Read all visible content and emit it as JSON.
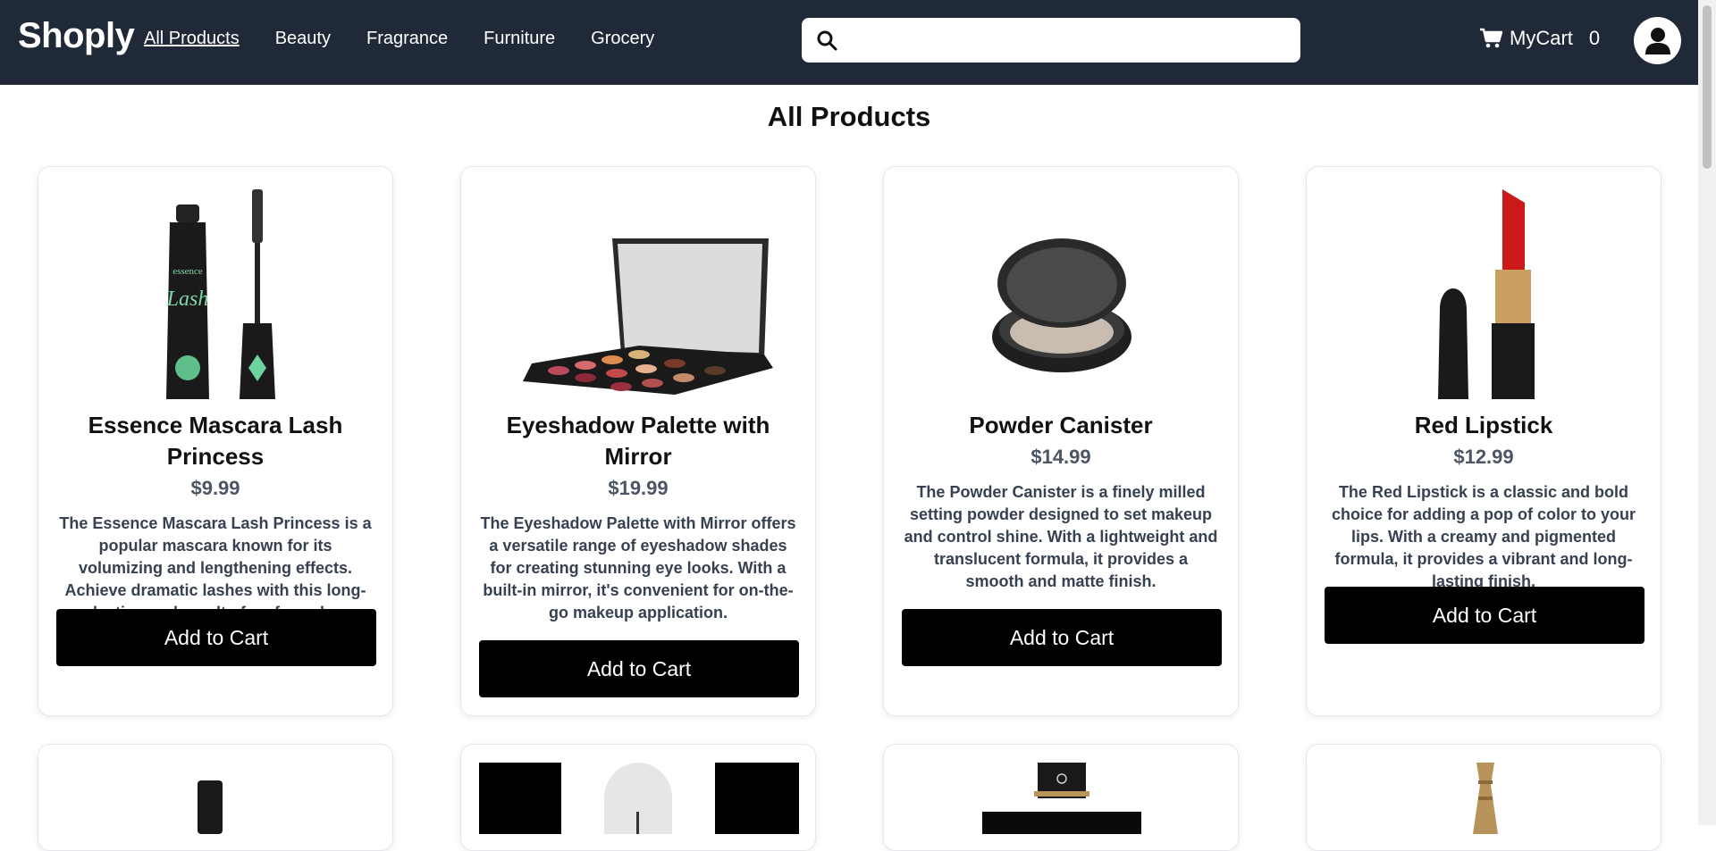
{
  "brand": "Shoply",
  "nav": {
    "links": [
      "All Products",
      "Beauty",
      "Fragrance",
      "Furniture",
      "Grocery"
    ]
  },
  "search": {
    "placeholder": "",
    "value": ""
  },
  "cart": {
    "label": "MyCart",
    "count": "0"
  },
  "page": {
    "title": "All Products"
  },
  "products": [
    {
      "title": "Essence Mascara Lash Princess",
      "price": "$9.99",
      "description": "The Essence Mascara Lash Princess is a popular mascara known for its volumizing and lengthening effects. Achieve dramatic lashes with this long-lasting and cruelty-free formula.",
      "button": "Add to Cart",
      "image_icon": "mascara-image"
    },
    {
      "title": "Eyeshadow Palette with Mirror",
      "price": "$19.99",
      "description": "The Eyeshadow Palette with Mirror offers a versatile range of eyeshadow shades for creating stunning eye looks. With a built-in mirror, it's convenient for on-the-go makeup application.",
      "button": "Add to Cart",
      "image_icon": "eyeshadow-palette-image"
    },
    {
      "title": "Powder Canister",
      "price": "$14.99",
      "description": "The Powder Canister is a finely milled setting powder designed to set makeup and control shine. With a lightweight and translucent formula, it provides a smooth and matte finish.",
      "button": "Add to Cart",
      "image_icon": "powder-canister-image"
    },
    {
      "title": "Red Lipstick",
      "price": "$12.99",
      "description": "The Red Lipstick is a classic and bold choice for adding a pop of color to your lips. With a creamy and pigmented formula, it provides a vibrant and long-lasting finish.",
      "button": "Add to Cart",
      "image_icon": "lipstick-image"
    }
  ],
  "colors": {
    "navbar": "#1f2937",
    "button": "#000000",
    "price": "#4b5563"
  }
}
